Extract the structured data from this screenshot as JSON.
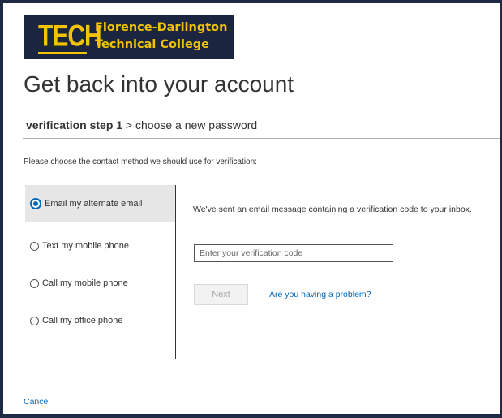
{
  "logo": {
    "mark": "TECH",
    "line1": "Florence-Darlington",
    "line2": "Technical College"
  },
  "title": "Get back into your account",
  "steps": {
    "current": "verification step 1",
    "separator": " > ",
    "next": "choose a new password"
  },
  "instruction": "Please choose the contact method we should use for verification:",
  "methods": [
    {
      "label": "Email my alternate email",
      "selected": true
    },
    {
      "label": "Text my mobile phone",
      "selected": false
    },
    {
      "label": "Call my mobile phone",
      "selected": false
    },
    {
      "label": "Call my office phone",
      "selected": false
    }
  ],
  "detail": {
    "message": "We've sent an email message containing a verification code to your inbox.",
    "code_placeholder": "Enter your verification code",
    "code_value": "",
    "next_label": "Next",
    "problem_link": "Are you having a problem?"
  },
  "cancel_label": "Cancel",
  "colors": {
    "brand_navy": "#1b2540",
    "brand_gold": "#f2c400",
    "link_blue": "#0067b8",
    "selected_bg": "#e6e6e6"
  }
}
